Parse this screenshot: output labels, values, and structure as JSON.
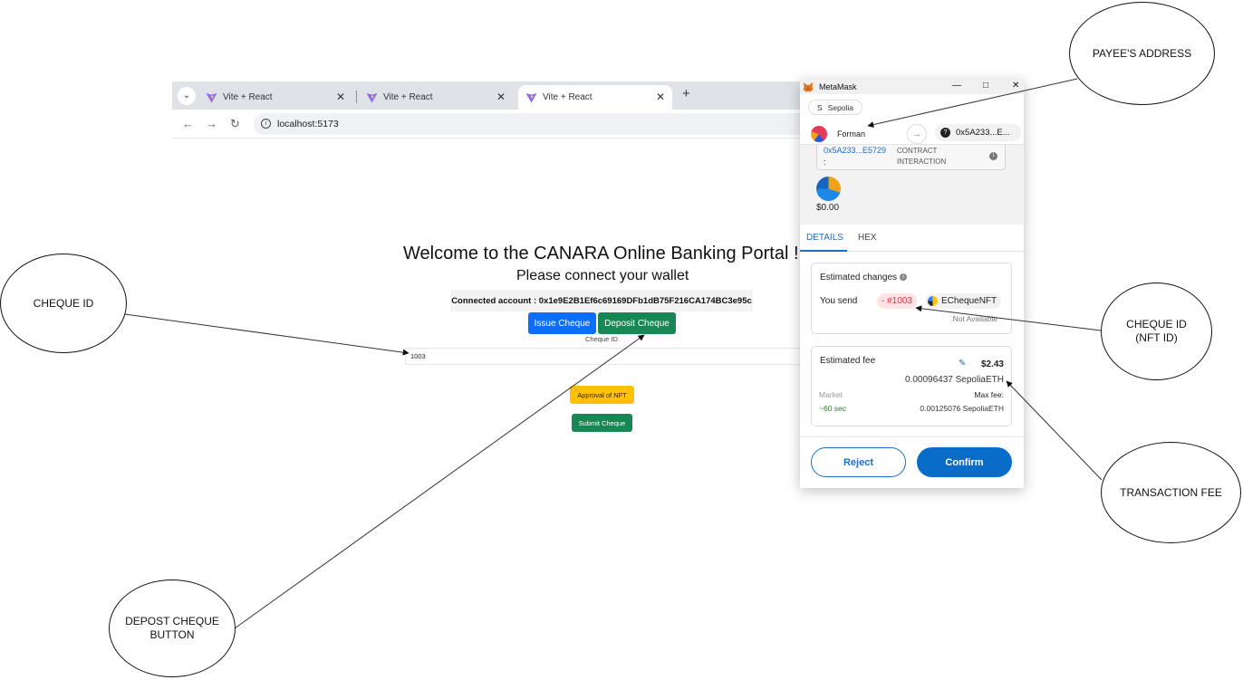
{
  "browser": {
    "tabs": [
      {
        "title": "Vite + React",
        "active": false
      },
      {
        "title": "Vite + React",
        "active": false
      },
      {
        "title": "Vite + React",
        "active": true
      }
    ],
    "url": "localhost:5173"
  },
  "page": {
    "title": "Welcome to the CANARA Online Banking Portal !",
    "subtitle": "Please connect your wallet",
    "connected_account": "Connected account : 0x1e9E2B1Ef6c69169DFb1dB75F216CA174BC3e95c",
    "issue_button": "Issue Cheque",
    "deposit_button": "Deposit Cheque",
    "cheque_label": "Cheque ID",
    "cheque_value": "1003",
    "approval_button": "Approval of NFT",
    "submit_button": "Submit Cheque"
  },
  "metamask": {
    "window_title": "MetaMask",
    "network": "Sepolia",
    "network_icon": "S",
    "from_account": "Forman",
    "to_address": "0x5A233...E...",
    "contract_address": "0x5A233...E5729",
    "contract_colon": ":",
    "contract_type_line1": "CONTRACT",
    "contract_type_line2": "INTERACTION",
    "value": "$0.00",
    "tabs": [
      "DETAILS",
      "HEX"
    ],
    "estimated_changes": {
      "title": "Estimated changes",
      "you_send": "You send",
      "nft_amount": "- #1003",
      "collection": "EChequeNFT",
      "note": "Not Available"
    },
    "estimated_fee": {
      "title": "Estimated fee",
      "usd": "$2.43",
      "eth": "0.00096437 SepoliaETH",
      "market_label": "Market",
      "max_fee_label": "Max fee:",
      "time": "~60 sec",
      "max_fee_value": "0.00125076 SepoliaETH"
    },
    "reject_button": "Reject",
    "confirm_button": "Confirm"
  },
  "annotations": {
    "payee": "PAYEE'S  ADDRESS",
    "cheque_id_left": "CHEQUE ID",
    "cheque_id_right": "CHEQUE ID\n(NFT ID)",
    "transaction_fee": "TRANSACTION  FEE",
    "deposit_button": "DEPOST CHEQUE\nBUTTON"
  },
  "colors": {
    "primary_button": "#0d6efd",
    "success_button": "#198754",
    "warning_button": "#ffc107",
    "metamask_blue": "#0a6cc9",
    "nft_red": "#d73847"
  }
}
